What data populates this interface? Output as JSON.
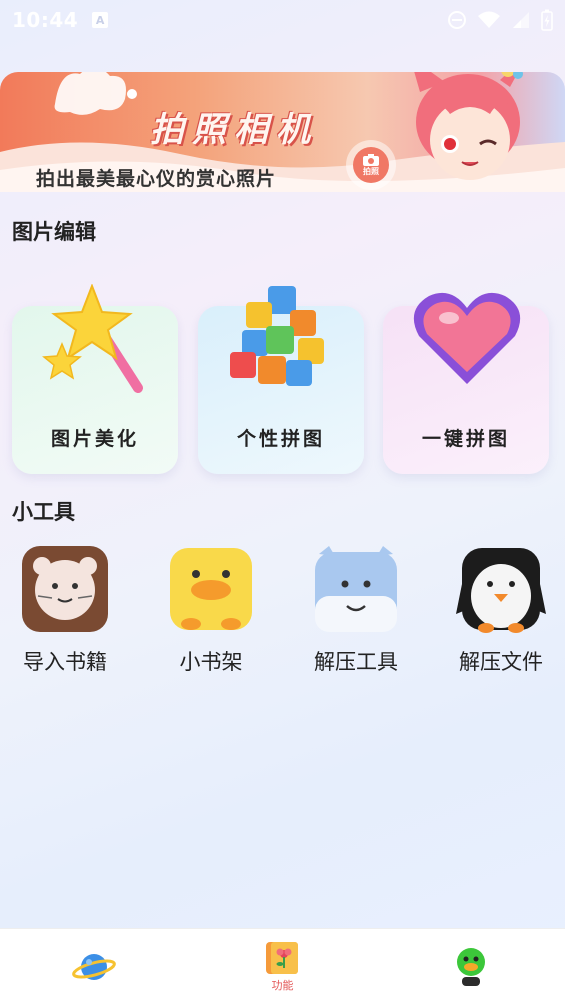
{
  "status_bar": {
    "time": "10:44",
    "notification_icon": "A"
  },
  "banner": {
    "title": "拍照相机",
    "subtitle": "拍出最美最心仪的赏心照片",
    "camera_label": "拍照"
  },
  "image_edit": {
    "heading": "图片编辑",
    "cards": [
      {
        "label": "图片美化",
        "icon": "magic-wand-icon",
        "color": "#e4f7ee"
      },
      {
        "label": "个性拼图",
        "icon": "cube-puzzle-icon",
        "color": "#dff1fb"
      },
      {
        "label": "一键拼图",
        "icon": "heart-icon",
        "color": "#f7e6f7"
      }
    ]
  },
  "tools": {
    "heading": "小工具",
    "items": [
      {
        "label": "导入书籍",
        "icon": "cat-face-icon"
      },
      {
        "label": "小书架",
        "icon": "duck-icon"
      },
      {
        "label": "解压工具",
        "icon": "blue-monster-icon"
      },
      {
        "label": "解压文件",
        "icon": "penguin-icon"
      }
    ]
  },
  "tab_bar": {
    "items": [
      {
        "label": "",
        "icon": "planet-icon"
      },
      {
        "label": "功能",
        "icon": "flower-book-icon",
        "active": true
      },
      {
        "label": "",
        "icon": "duck-avatar-icon"
      }
    ]
  },
  "colors": {
    "accent": "#e35656",
    "banner_orange": "#f27a5a"
  }
}
